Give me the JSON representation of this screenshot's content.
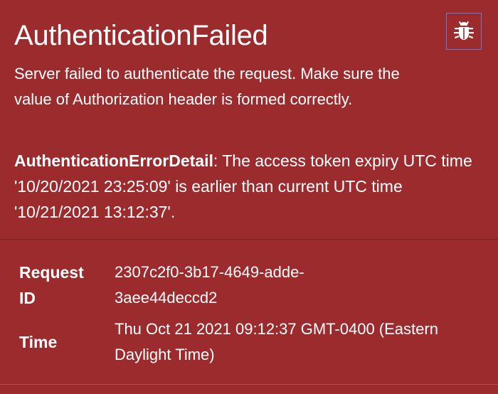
{
  "error": {
    "title": "AuthenticationFailed",
    "message": "Server failed to authenticate the request. Make sure the value of Authorization header is formed correctly.",
    "detail_key": "AuthenticationErrorDetail",
    "detail_separator": ":",
    "detail_value": " The access token expiry UTC time '10/20/2021 23:25:09' is earlier than current UTC time '10/21/2021 13:12:37'."
  },
  "actions": {
    "bug_icon": "bug-icon"
  },
  "meta": {
    "request_id_label": "Request ID",
    "request_id_value": "2307c2f0-3b17-4649-adde-3aee44deccd2",
    "time_label": "Time",
    "time_value": "Thu Oct 21 2021 09:12:37 GMT-0400 (Eastern Daylight Time)"
  },
  "colors": {
    "background": "#9c2b2e",
    "text": "#ffffff",
    "focus_outline": "#5b7fe0"
  }
}
